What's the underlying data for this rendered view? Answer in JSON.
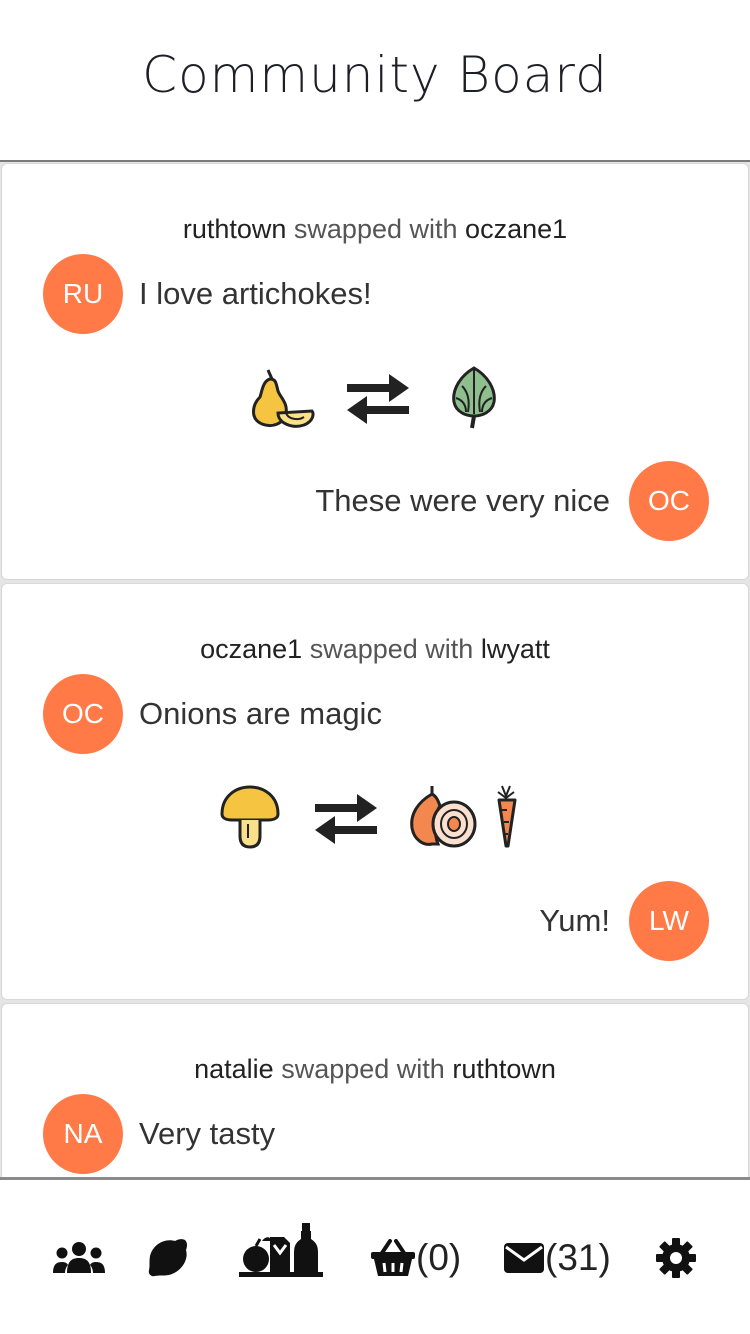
{
  "header": {
    "title": "Community Board"
  },
  "feed": {
    "swapped_with_text": "swapped with",
    "cards": [
      {
        "from_user": "ruthtown",
        "to_user": "oczane1",
        "from_initials": "RU",
        "from_message": "I love artichokes!",
        "to_initials": "OC",
        "to_message": "These were very nice",
        "give_icons": [
          "pear-icon"
        ],
        "receive_icons": [
          "artichoke-icon"
        ]
      },
      {
        "from_user": "oczane1",
        "to_user": "lwyatt",
        "from_initials": "OC",
        "from_message": "Onions are magic",
        "to_initials": "LW",
        "to_message": "Yum!",
        "give_icons": [
          "mushroom-icon"
        ],
        "receive_icons": [
          "onion-icon",
          "carrot-icon"
        ]
      },
      {
        "from_user": "natalie",
        "to_user": "ruthtown",
        "from_initials": "NA",
        "from_message": "Very tasty"
      }
    ]
  },
  "nav": {
    "items": [
      {
        "icon": "users-icon"
      },
      {
        "icon": "lemon-icon"
      },
      {
        "icon": "groceries-icon"
      },
      {
        "icon": "basket-icon",
        "count": "(0)"
      },
      {
        "icon": "envelope-icon",
        "count": "(31)"
      },
      {
        "icon": "gear-icon"
      }
    ]
  },
  "colors": {
    "avatar": "#ff7a47",
    "accent_dark": "#222222"
  }
}
